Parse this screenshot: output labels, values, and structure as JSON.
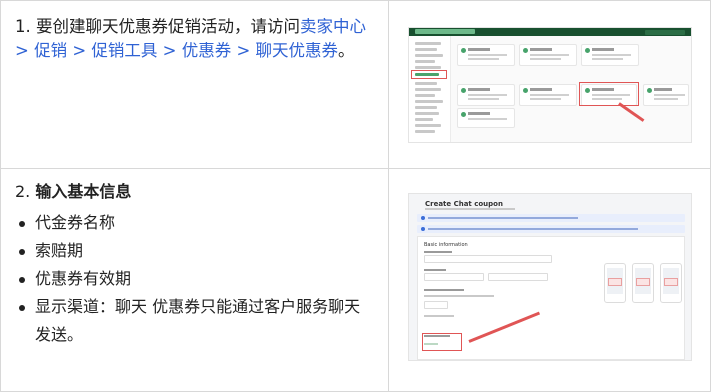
{
  "steps": [
    {
      "number": "1.",
      "text_before": "要创建聊天优惠券促销活动，请访问",
      "link": "卖家中心 > 促销 > 促销工具 > 优惠券 > 聊天优惠券",
      "text_after": "。"
    },
    {
      "number": "2.",
      "title": "输入基本信息",
      "bullets": [
        "代金券名称",
        "索赔期",
        "优惠券有效期",
        "显示渠道：聊天 优惠券只能通过客户服务聊天发送。"
      ]
    }
  ],
  "screenshot2": {
    "title": "Create Chat coupon",
    "section": "Basic information"
  },
  "colors": {
    "link": "#2f62d4",
    "highlight": "#e05555",
    "brand_green": "#18502f"
  }
}
